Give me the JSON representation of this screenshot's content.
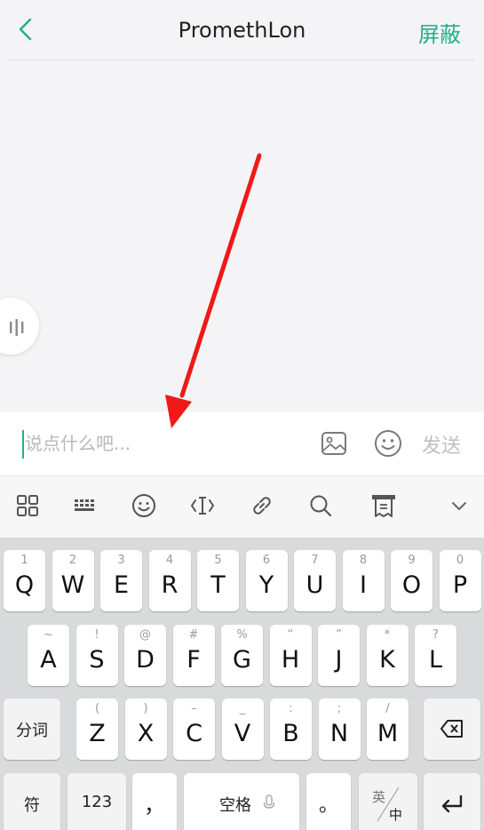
{
  "header": {
    "title": "PromethLon",
    "block_label": "屏蔽"
  },
  "composer": {
    "placeholder": "说点什么吧...",
    "send_label": "发送"
  },
  "toolbar": {
    "icons": [
      "grid-icon",
      "keyboard-icon",
      "emoji-icon",
      "cursor-icon",
      "link-icon",
      "search-icon",
      "receipt-icon",
      "chevron-down-icon"
    ]
  },
  "keyboard": {
    "row1": [
      {
        "key": "Q",
        "sub": "1"
      },
      {
        "key": "W",
        "sub": "2"
      },
      {
        "key": "E",
        "sub": "3"
      },
      {
        "key": "R",
        "sub": "4"
      },
      {
        "key": "T",
        "sub": "5"
      },
      {
        "key": "Y",
        "sub": "6"
      },
      {
        "key": "U",
        "sub": "7"
      },
      {
        "key": "I",
        "sub": "8"
      },
      {
        "key": "O",
        "sub": "9"
      },
      {
        "key": "P",
        "sub": "0"
      }
    ],
    "row2": [
      {
        "key": "A",
        "sub": "~"
      },
      {
        "key": "S",
        "sub": "!"
      },
      {
        "key": "D",
        "sub": "@"
      },
      {
        "key": "F",
        "sub": "#"
      },
      {
        "key": "G",
        "sub": "%"
      },
      {
        "key": "H",
        "sub": "“"
      },
      {
        "key": "J",
        "sub": "”"
      },
      {
        "key": "K",
        "sub": "*"
      },
      {
        "key": "L",
        "sub": "?"
      }
    ],
    "row3": [
      {
        "key": "Z",
        "sub": "("
      },
      {
        "key": "X",
        "sub": ")"
      },
      {
        "key": "C",
        "sub": "–"
      },
      {
        "key": "V",
        "sub": "_"
      },
      {
        "key": "B",
        "sub": ":"
      },
      {
        "key": "N",
        "sub": ";"
      },
      {
        "key": "M",
        "sub": "/"
      }
    ],
    "segment_label": "分词",
    "symbol_label": "符",
    "numbers_label": "123",
    "comma_label": "，",
    "space_label": "空格",
    "period_label": "。",
    "lang_top": "英",
    "lang_bottom": "中"
  },
  "colors": {
    "accent": "#21b08e",
    "arrow": "#f01818"
  }
}
